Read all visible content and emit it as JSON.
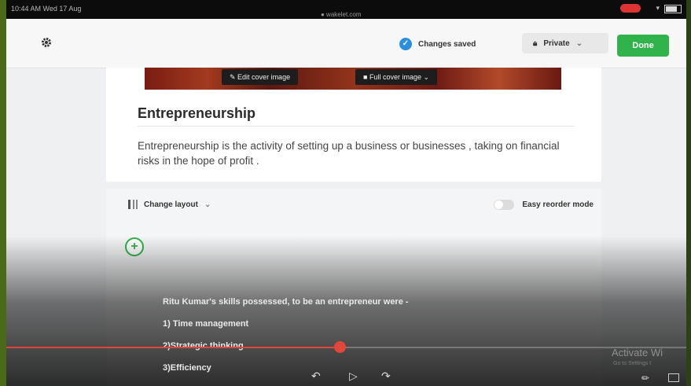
{
  "status_bar": {
    "time": "10:44 AM  Wed 17 Aug",
    "url": "● wakelet.com"
  },
  "toolbar": {
    "saved_label": "Changes saved",
    "privacy_label": "Private",
    "done_label": "Done"
  },
  "cover": {
    "edit_label": "Edit cover image",
    "full_label": "Full cover image"
  },
  "collection": {
    "title": "Entrepreneurship",
    "description": "Entrepreneurship is the activity of setting up a business or businesses , taking on financial risks in the hope of profit ."
  },
  "layout_bar": {
    "change_layout_label": "Change layout",
    "reorder_label": "Easy reorder mode"
  },
  "post_lines": [
    "Ritu Kumar's skills possessed, to be an entrepreneur were -",
    "1) Time management",
    "2)Strategic thinking",
    "3)Efficiency"
  ],
  "video": {
    "progress": 0.49
  },
  "watermark": {
    "line1": "Activate Wi",
    "line2": "Go to Settings t"
  },
  "colors": {
    "accent": "#2fb34a",
    "saved_check": "#2a8fe0",
    "scrubber": "#e0463a"
  }
}
